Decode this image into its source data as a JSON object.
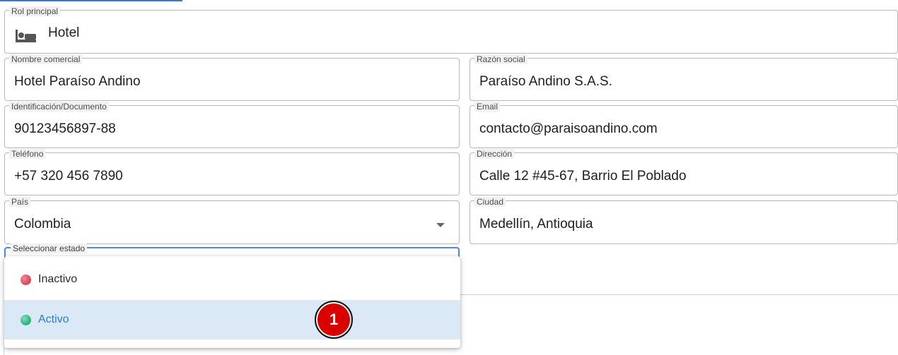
{
  "form": {
    "role": {
      "label": "Rol principal",
      "value": "Hotel",
      "icon": "bed-icon"
    },
    "commercial_name": {
      "label": "Nombre comercial",
      "value": "Hotel Paraíso Andino"
    },
    "business_name": {
      "label": "Razón social",
      "value": "Paraíso Andino S.A.S."
    },
    "identification": {
      "label": "Identificación/Documento",
      "value": "90123456897-88"
    },
    "email": {
      "label": "Email",
      "value": "contacto@paraisoandino.com"
    },
    "phone": {
      "label": "Teléfono",
      "value": "+57 320 456 7890"
    },
    "address": {
      "label": "Dirección",
      "value": "Calle 12 #45-67, Barrio El Poblado"
    },
    "country": {
      "label": "País",
      "value": "Colombia",
      "icon": "chevron-down-icon"
    },
    "city": {
      "label": "Ciudad",
      "value": "Medellín, Antioquia"
    },
    "status": {
      "label": "Seleccionar estado",
      "options": [
        {
          "label": "Inactivo",
          "color": "#df4f62"
        },
        {
          "label": "Activo",
          "color": "#35b889",
          "highlighted": true
        }
      ]
    }
  },
  "annotation": {
    "marker": "1",
    "color": "#d90000"
  },
  "colors": {
    "accent": "#3a78c9",
    "selected_background": "#dbe9f6",
    "selected_text": "#2f7acb"
  }
}
